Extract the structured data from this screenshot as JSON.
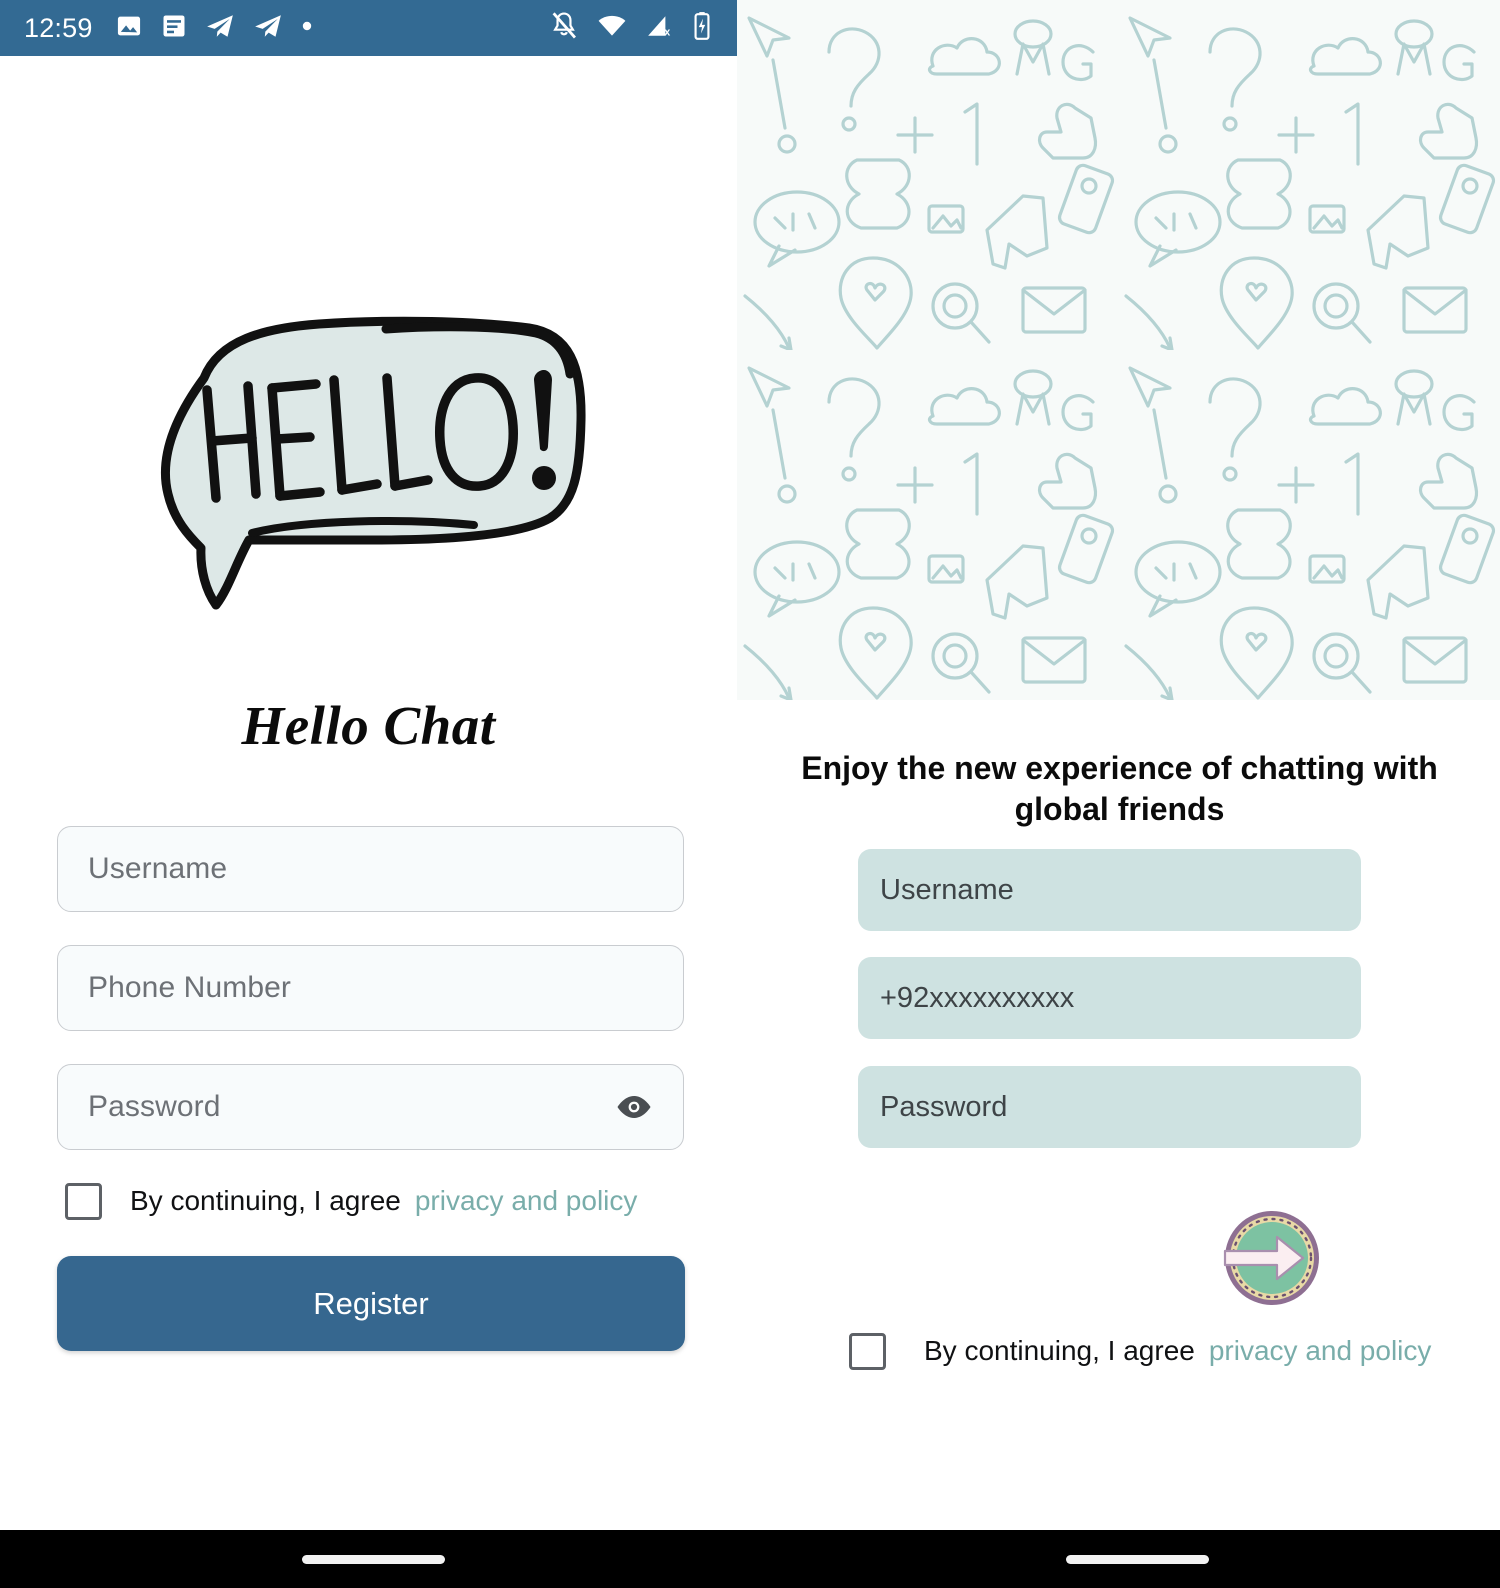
{
  "status_bar": {
    "time": "12:59",
    "left_icons": [
      "image-icon",
      "article-icon",
      "telegram-icon",
      "telegram-icon",
      "dot-icon"
    ],
    "right_icons": [
      "bell-off-icon",
      "wifi-icon",
      "signal-no-sim-icon",
      "battery-charging-icon"
    ],
    "background_color": "#336a93",
    "foreground_color": "#ffffff"
  },
  "left_panel": {
    "logo": {
      "name": "hello-speech-bubble-logo",
      "text": "HELLO!",
      "fill_color": "#dde8e7",
      "stroke_color": "#111111"
    },
    "app_title": "Hello Chat",
    "fields": [
      {
        "name": "username",
        "placeholder": "Username",
        "value": ""
      },
      {
        "name": "phone",
        "placeholder": "Phone Number",
        "value": ""
      },
      {
        "name": "password",
        "placeholder": "Password",
        "value": "",
        "trailing_icon": "eye-icon"
      }
    ],
    "consent": {
      "checked": false,
      "text": "By continuing, I agree",
      "link_text": "privacy and policy",
      "link_color": "#79adaa"
    },
    "register_button": {
      "label": "Register",
      "background_color": "#36678f",
      "text_color": "#ffffff"
    }
  },
  "right_panel": {
    "banner": {
      "name": "doodle-pattern-banner",
      "background_color": "#f7faf9",
      "doodle_color": "#b4d2d2",
      "motifs": [
        "question-mark",
        "exclamation-mark",
        "omg-text",
        "cloud",
        "plus-one",
        "thumbs-up",
        "speech-bubble",
        "location-pin-heart",
        "envelope",
        "magnifier",
        "phone",
        "megaphone",
        "plus-sign",
        "hourglass",
        "arrow",
        "cursor"
      ]
    },
    "promo_text": "Enjoy the new experience of chatting with global friends",
    "fields": [
      {
        "name": "username",
        "placeholder": "Username",
        "value": ""
      },
      {
        "name": "phone",
        "placeholder": "+92xxxxxxxxxx",
        "value": ""
      },
      {
        "name": "password",
        "placeholder": "Password",
        "value": ""
      }
    ],
    "field_background_color": "#cee2e1",
    "submit_button": {
      "name": "arrow-forward-button",
      "icon": "arrow-right-circle-icon",
      "ring_outer_color": "#8e6f92",
      "ring_inner_color": "#e8d9a6",
      "disc_color": "#7dc2a2",
      "arrow_color": "#fbeef1"
    },
    "consent": {
      "checked": false,
      "text": "By continuing, I agree",
      "link_text": "privacy and policy",
      "link_color": "#79adaa"
    }
  },
  "nav_bar": {
    "background_color": "#000000",
    "home_indicators": 2
  }
}
